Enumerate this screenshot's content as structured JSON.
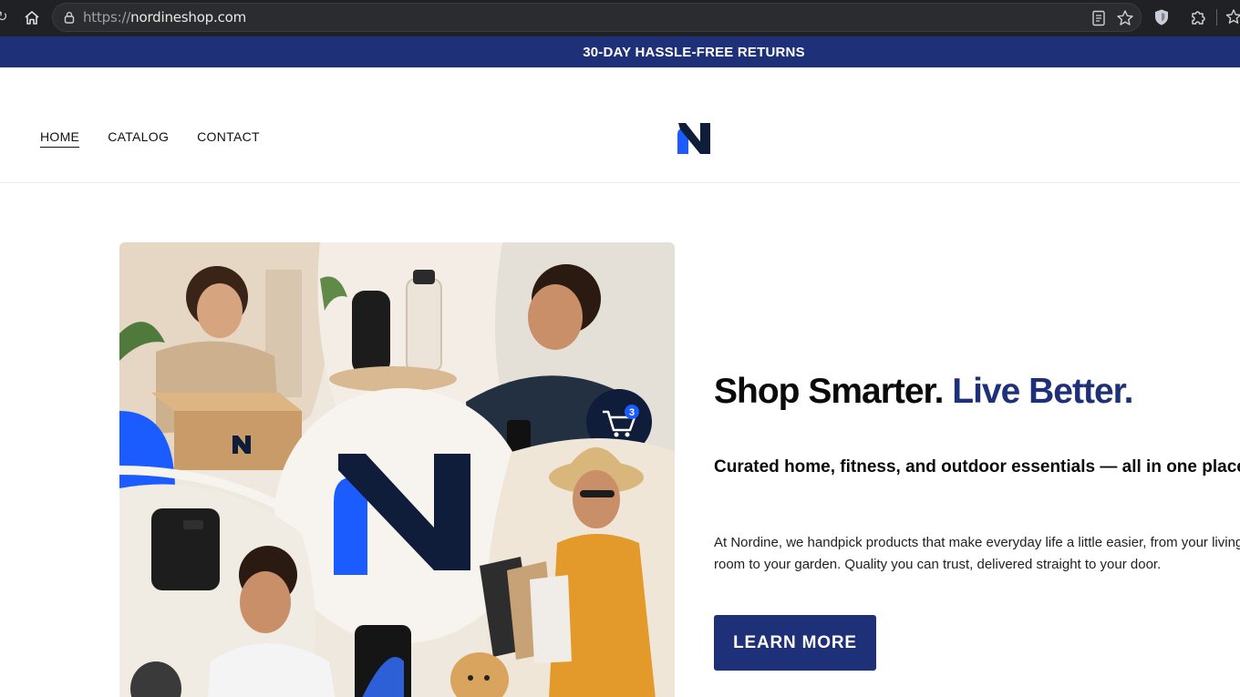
{
  "browser": {
    "url_protocol": "https://",
    "url_host": "nordineshop.com",
    "icons": [
      "home-icon",
      "lock-icon",
      "reader-view-icon",
      "bookmark-star-icon",
      "shield-extension-icon",
      "puzzle-extension-icon",
      "favorites-icon"
    ]
  },
  "announcement": {
    "text": "30-DAY HASSLE-FREE RETURNS"
  },
  "nav": {
    "items": [
      {
        "label": "HOME"
      },
      {
        "label": "CATALOG"
      },
      {
        "label": "CONTACT"
      }
    ]
  },
  "hero": {
    "title_main": "Shop Smarter. ",
    "title_accent": "Live Better.",
    "subtitle": "Curated home, fitness, and outdoor essentials — all in one place",
    "body": "At Nordine, we handpick products that make everyday life a little easier, from your living room to your garden. Quality you can trust, delivered straight to your door.",
    "cta_label": "LEARN MORE",
    "image": {
      "cart_badge_count": "3"
    }
  },
  "colors": {
    "brand_navy": "#1e3078",
    "brand_blue": "#1a5cff",
    "dark_navy": "#0f1c3a"
  }
}
